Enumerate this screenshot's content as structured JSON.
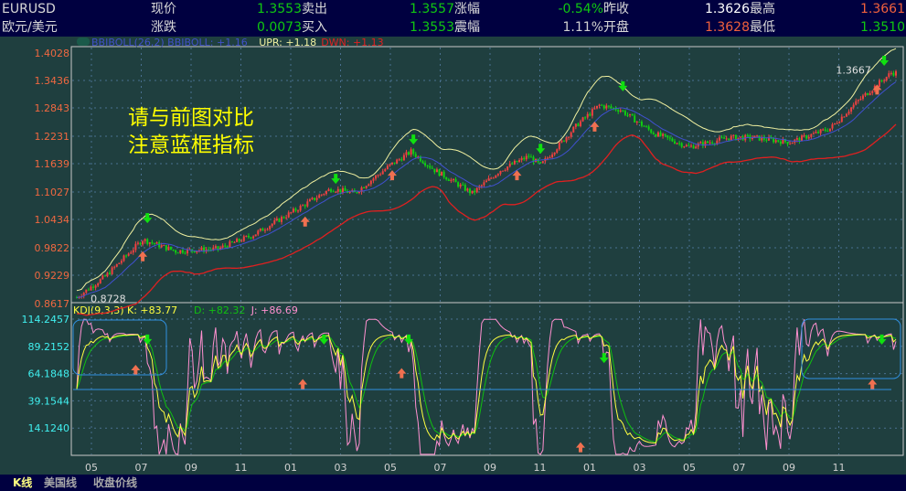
{
  "quote": {
    "symbol": "EURUSD",
    "name": "欧元/美元",
    "rows": [
      [
        {
          "l": "现价",
          "v": "1.3553",
          "c": "g"
        },
        {
          "l": "卖出",
          "v": "1.3557",
          "c": "g"
        },
        {
          "l": "涨幅",
          "v": "-0.54%",
          "c": "g"
        },
        {
          "l": "昨收",
          "v": "1.3626",
          "c": "w"
        },
        {
          "l": "最高",
          "v": "1.3661",
          "c": "r"
        }
      ],
      [
        {
          "l": "涨跌",
          "v": "0.0073",
          "c": "g"
        },
        {
          "l": "买入",
          "v": "1.3553",
          "c": "g"
        },
        {
          "l": "震幅",
          "v": "1.11%",
          "c": "gr"
        },
        {
          "l": "开盘",
          "v": "1.3628",
          "c": "r"
        },
        {
          "l": "最低",
          "v": "1.3510",
          "c": "g"
        }
      ]
    ]
  },
  "annotation": [
    "请与前图对比",
    "注意蓝框指标"
  ],
  "tabs": [
    "K线",
    "美国线",
    "收盘价线"
  ],
  "chart_data": [
    {
      "type": "candlestick",
      "title": "BBIBOLL(26,2)",
      "legend": [
        {
          "text": "BBIBOLL(26,2) BBIBOLL: +1.16",
          "color": "#4050c8"
        },
        {
          "text": "UPR: +1.18",
          "color": "#f0f0a0"
        },
        {
          "text": "DWN: +1.13",
          "color": "#e02020"
        }
      ],
      "ylim": [
        0.8617,
        1.4028
      ],
      "yticks": [
        "1.4028",
        "1.3436",
        "1.2843",
        "1.2231",
        "1.1639",
        "1.1027",
        "1.0434",
        "0.9822",
        "0.9229",
        "0.8617"
      ],
      "xticks": [
        "05",
        "07",
        "09",
        "11",
        "01",
        "03",
        "05",
        "07",
        "09",
        "11",
        "01",
        "03",
        "05",
        "07",
        "09",
        "11"
      ],
      "price_path": [
        [
          0,
          0.875
        ],
        [
          12,
          0.92
        ],
        [
          28,
          1.0
        ],
        [
          42,
          0.975
        ],
        [
          60,
          0.98
        ],
        [
          75,
          1.01
        ],
        [
          95,
          1.07
        ],
        [
          108,
          1.11
        ],
        [
          118,
          1.1
        ],
        [
          133,
          1.16
        ],
        [
          142,
          1.19
        ],
        [
          152,
          1.15
        ],
        [
          168,
          1.1
        ],
        [
          180,
          1.15
        ],
        [
          192,
          1.18
        ],
        [
          197,
          1.16
        ],
        [
          213,
          1.25
        ],
        [
          222,
          1.29
        ],
        [
          231,
          1.28
        ],
        [
          245,
          1.23
        ],
        [
          260,
          1.2
        ],
        [
          277,
          1.22
        ],
        [
          288,
          1.22
        ],
        [
          303,
          1.21
        ],
        [
          320,
          1.24
        ],
        [
          332,
          1.3
        ],
        [
          346,
          1.36
        ]
      ],
      "labels": [
        {
          "text": "0.8728",
          "x": 2,
          "p": 0.8728
        },
        {
          "text": "1.3667",
          "x": 340,
          "p": 1.3667
        }
      ],
      "signals_down": [
        [
          30,
          1.045
        ],
        [
          110,
          1.13
        ],
        [
          143,
          1.215
        ],
        [
          197,
          1.195
        ],
        [
          232,
          1.33
        ],
        [
          343,
          1.385
        ]
      ],
      "signals_up": [
        [
          28,
          0.965
        ],
        [
          97,
          1.04
        ],
        [
          134,
          1.14
        ],
        [
          187,
          1.14
        ],
        [
          220,
          1.245
        ],
        [
          340,
          1.325
        ]
      ]
    },
    {
      "type": "line",
      "title": "KDJ(9,3,3)",
      "legend": [
        {
          "text": "KDJ(9,3,3) K: +83.77",
          "color": "#ffff40"
        },
        {
          "text": "D: +82.32",
          "color": "#10c010"
        },
        {
          "text": "J: +86.69",
          "color": "#ff90d0"
        }
      ],
      "ylim": [
        -10.9,
        114.2457
      ],
      "yticks": [
        "114.2457",
        "89.2152",
        "64.1848",
        "39.1544",
        "14.1240"
      ],
      "last": {
        "K": 83.77,
        "D": 82.32,
        "J": 86.69
      },
      "signals_down": [
        [
          30,
          95
        ],
        [
          105,
          95
        ],
        [
          141,
          95
        ],
        [
          224,
          78
        ],
        [
          342,
          95
        ]
      ],
      "signals_up": [
        [
          25,
          68
        ],
        [
          96,
          55
        ],
        [
          138,
          65
        ],
        [
          214,
          -3
        ],
        [
          338,
          55
        ]
      ]
    }
  ]
}
